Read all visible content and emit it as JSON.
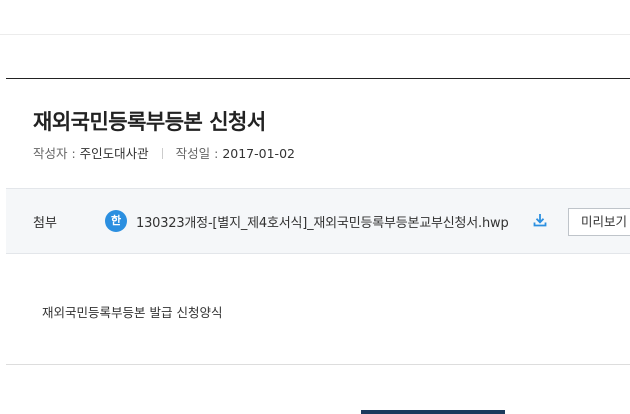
{
  "post": {
    "title": "재외국민등록부등본 신청서",
    "author_label": "작성자 : ",
    "author": "주인도대사관",
    "date_label": "작성일 : ",
    "date": "2017-01-02"
  },
  "attachment": {
    "label": "첨부",
    "file_icon": "hwp-file-icon",
    "file_icon_glyph": "한",
    "file_name": "130323개정-[별지_제4호서식]_재외국민등록부등본교부신청서.hwp",
    "download_icon": "download-icon",
    "preview_label": "미리보기"
  },
  "content": {
    "text": "재외국민등록부등본 발급 신청양식"
  },
  "colors": {
    "accent": "#2b8fe0",
    "attach_bg": "#f5f7f9",
    "list_button": "#1b3a5c"
  }
}
